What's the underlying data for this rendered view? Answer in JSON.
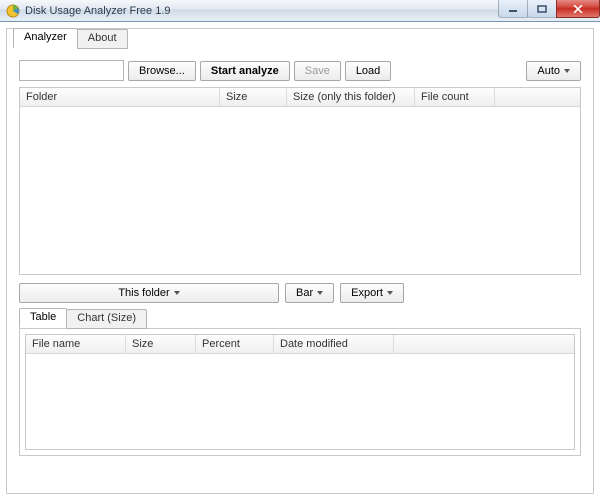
{
  "window": {
    "title": "Disk Usage Analyzer Free 1.9"
  },
  "mainTabs": {
    "analyzer": "Analyzer",
    "about": "About"
  },
  "toolbar": {
    "path_value": "",
    "browse": "Browse...",
    "start": "Start analyze",
    "save": "Save",
    "load": "Load",
    "auto": "Auto"
  },
  "topColumns": {
    "folder": "Folder",
    "size": "Size",
    "size_only": "Size (only this folder)",
    "file_count": "File count"
  },
  "mid": {
    "this_folder": "This folder",
    "bar": "Bar",
    "export": "Export"
  },
  "bottomTabs": {
    "table": "Table",
    "chart": "Chart (Size)"
  },
  "bottomColumns": {
    "file_name": "File name",
    "size": "Size",
    "percent": "Percent",
    "date_modified": "Date modified"
  }
}
